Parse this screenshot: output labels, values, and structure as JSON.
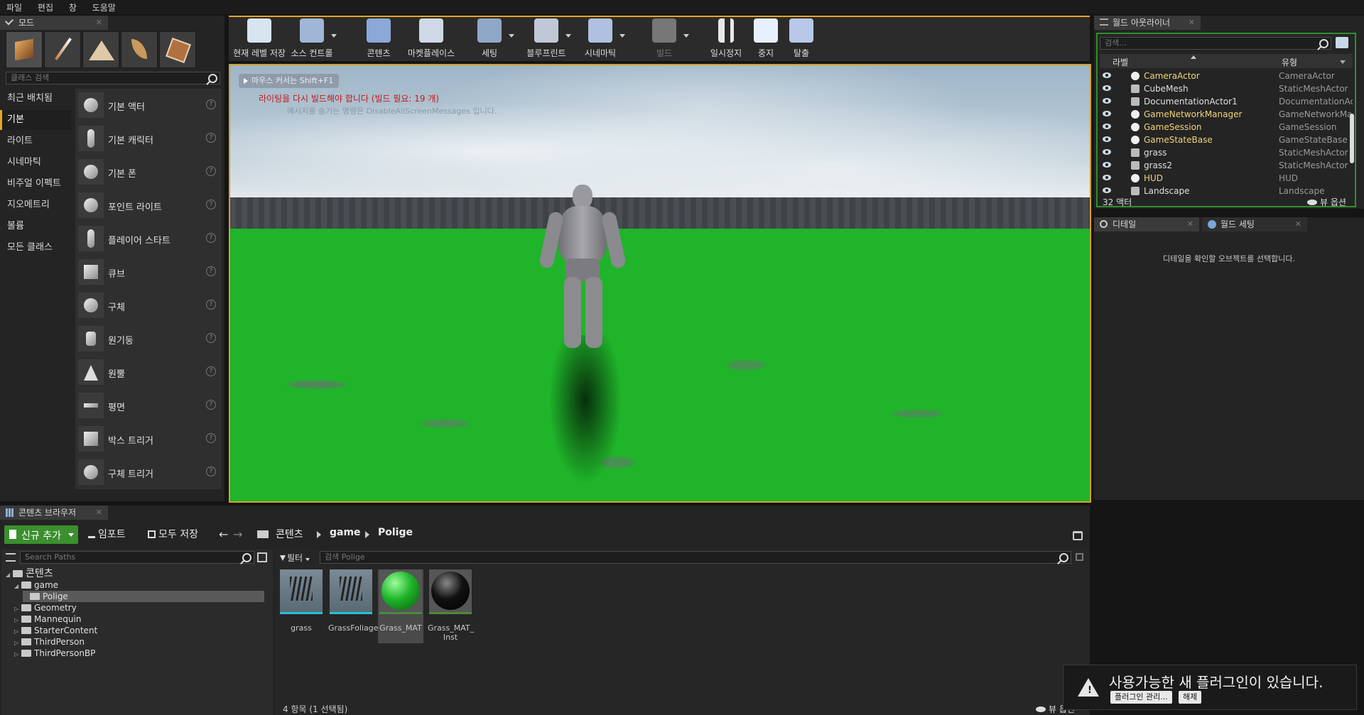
{
  "menu": [
    "파일",
    "편집",
    "창",
    "도움말"
  ],
  "modes": {
    "tab": "모드",
    "search_placeholder": "클래스 검색",
    "categories": [
      "최근 배치됨",
      "기본",
      "라이트",
      "시네마틱",
      "비주얼 이펙트",
      "지오메트리",
      "볼륨",
      "모든 클래스"
    ],
    "items": [
      "기본 액터",
      "기본 캐릭터",
      "기본 폰",
      "포인트 라이트",
      "플레이어 스타트",
      "큐브",
      "구체",
      "원기둥",
      "원뿔",
      "평면",
      "박스 트리거",
      "구체 트리거"
    ],
    "help_glyph": "?"
  },
  "toolbar": {
    "buttons": [
      "현재 레벨 저장",
      "소스 컨트롤",
      "콘텐츠",
      "마켓플레이스",
      "세팅",
      "블루프린트",
      "시네마틱",
      "빌드",
      "일시정지",
      "중지",
      "탈출"
    ]
  },
  "viewport": {
    "hint": "마우스 커서는 Shift+F1",
    "warning": "라이팅을 다시 빌드해야 합니다 (빌드 필요: 19 개)",
    "info": "메시지를 숨기는 명령은 DisableAllScreenMessages 입니다."
  },
  "outliner": {
    "tab": "월드 아웃라이너",
    "search_placeholder": "검색...",
    "col_label": "라벨",
    "col_type": "유형",
    "rows": [
      {
        "name": "CameraActor",
        "type": "CameraActor",
        "highlight": true
      },
      {
        "name": "CubeMesh",
        "type": "StaticMeshActor",
        "highlight": false
      },
      {
        "name": "DocumentationActor1",
        "type": "DocumentationAc",
        "highlight": false
      },
      {
        "name": "GameNetworkManager",
        "type": "GameNetworkMar",
        "highlight": true
      },
      {
        "name": "GameSession",
        "type": "GameSession",
        "highlight": true
      },
      {
        "name": "GameStateBase",
        "type": "GameStateBase",
        "highlight": true
      },
      {
        "name": "grass",
        "type": "StaticMeshActor",
        "highlight": false
      },
      {
        "name": "grass2",
        "type": "StaticMeshActor",
        "highlight": false
      },
      {
        "name": "HUD",
        "type": "HUD",
        "highlight": true
      },
      {
        "name": "Landscape",
        "type": "Landscape",
        "highlight": false
      }
    ],
    "count": "32 액터",
    "view_options": "뷰 옵션"
  },
  "details": {
    "tab_details": "디테일",
    "tab_world": "월드 세팅",
    "empty_msg": "디테일을 확인할 오브젝트를 선택합니다."
  },
  "content_browser": {
    "tab": "콘텐츠 브라우저",
    "add_new": "신규 추가",
    "import": "임포트",
    "save_all": "모두 저장",
    "breadcrumb": [
      "콘텐츠",
      "game",
      "Polige"
    ],
    "path_search_placeholder": "Search Paths",
    "filter": "필터",
    "asset_search_placeholder": "검색 Polige",
    "tree": [
      {
        "label": "콘텐츠",
        "depth": 0,
        "expanded": true
      },
      {
        "label": "game",
        "depth": 1,
        "expanded": true
      },
      {
        "label": "Polige",
        "depth": 2,
        "selected": true
      },
      {
        "label": "Geometry",
        "depth": 1
      },
      {
        "label": "Mannequin",
        "depth": 1
      },
      {
        "label": "StarterContent",
        "depth": 1
      },
      {
        "label": "ThirdPerson",
        "depth": 1
      },
      {
        "label": "ThirdPersonBP",
        "depth": 1
      }
    ],
    "assets": [
      {
        "name": "grass",
        "kind": "mesh"
      },
      {
        "name": "GrassFoliage",
        "kind": "mesh"
      },
      {
        "name": "Grass_MAT",
        "kind": "green-sphere",
        "selected": true
      },
      {
        "name": "Grass_MAT_\nInst",
        "kind": "black-sphere"
      }
    ],
    "status": "4 항목 (1 선택됨)",
    "view_options": "뷰 옵션"
  },
  "notification": {
    "message": "사용가능한 새 플러그인이 있습니다.",
    "manage": "플러그인 관리...",
    "dismiss": "해제"
  },
  "colors": {
    "accent": "#e8a526",
    "grass": "#1fb42a",
    "add_button": "#3b8f2e",
    "outliner_highlight": "#f1d37a"
  }
}
